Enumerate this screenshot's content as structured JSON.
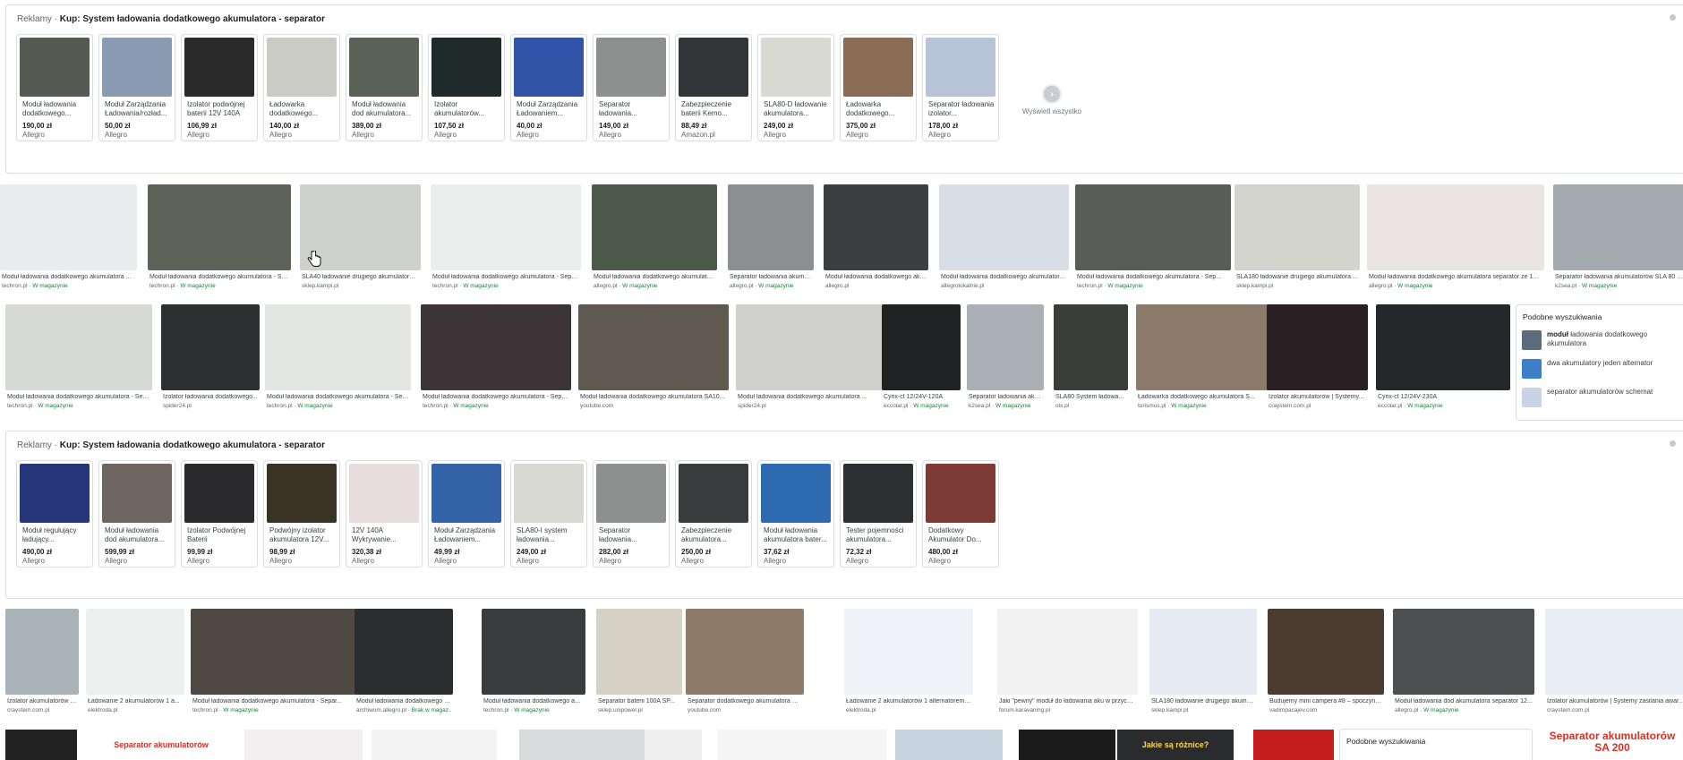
{
  "ads_top": {
    "prefix": "Reklamy · ",
    "title": "Kup: System ładowania dodatkowego akumulatora - separator",
    "cards": [
      {
        "title": "Moduł ładowania dodatkowego...",
        "price": "190,00 zł",
        "store": "Allegro",
        "color": "#555b52"
      },
      {
        "title": "Moduł Zarządzania Ładowania/rozład...",
        "price": "50,00 zł",
        "store": "Allegro",
        "color": "#8a9bb3"
      },
      {
        "title": "Izolator podwójnej baterii 12V 140A",
        "price": "106,99 zł",
        "store": "Allegro",
        "color": "#2a2a2a"
      },
      {
        "title": "Ładowarka dodatkowego...",
        "price": "140,00 zł",
        "store": "Allegro",
        "color": "#c9cbc4"
      },
      {
        "title": "Moduł ładowania dod akumulatora...",
        "price": "389,00 zł",
        "store": "Allegro",
        "color": "#5a6156"
      },
      {
        "title": "Izolator akumulatorów...",
        "price": "107,50 zł",
        "store": "Allegro",
        "color": "#1f2b2a"
      },
      {
        "title": "Moduł Zarządzania Ładowaniem...",
        "price": "40,00 zł",
        "store": "Allegro",
        "color": "#2f54a8"
      },
      {
        "title": "Separator ładowania...",
        "price": "149,00 zł",
        "store": "Allegro",
        "color": "#8e9090"
      },
      {
        "title": "Zabezpieczenie baterii Kemo...",
        "price": "88,49 zł",
        "store": "Amazon.pl",
        "color": "#333638"
      },
      {
        "title": "SLA80-D ładowanie akumulatora...",
        "price": "249,00 zł",
        "store": "Allegro",
        "color": "#d8d9d2"
      },
      {
        "title": "Ładowarka dodatkowego...",
        "price": "375,00 zł",
        "store": "Allegro",
        "color": "#8b6d55"
      },
      {
        "title": "Separator ładowania izolator...",
        "price": "178,00 zł",
        "store": "Allegro",
        "color": "#b7c3d6"
      }
    ],
    "show_all": "Wyświetl wszystko"
  },
  "row1": [
    {
      "cap": "Moduł ładowania dodatkowego akumulatora ...",
      "src": "techron.pl",
      "stock": " · W magazynie",
      "color": "#e9ecef"
    },
    {
      "cap": "Moduł ładowania dodatkowego akumulatora - Se...",
      "src": "techron.pl",
      "stock": " · W magazynie",
      "color": "#5d6359"
    },
    {
      "cap": "SLA40 ładowanie drugiego akumulatora ...",
      "src": "sklep.kampi.pl",
      "stock": "",
      "color": "#cfd1cc"
    },
    {
      "cap": "Moduł ładowania dodatkowego akumulatora - Separ...",
      "src": "techron.pl",
      "stock": " · W magazynie",
      "color": "#eceeee"
    },
    {
      "cap": "Moduł ładowania dodatkowego akumulatora ...",
      "src": "allegro.pl",
      "stock": " · W magazynie",
      "color": "#4c5a4a"
    },
    {
      "cap": "Separator ładowania akumul...",
      "src": "allegro.pl",
      "stock": " · W magazynie",
      "color": "#8c8f91"
    },
    {
      "cap": "Moduł ładowania dodatkowego aku...",
      "src": "allegro.pl",
      "stock": "",
      "color": "#3c3f42"
    },
    {
      "cap": "Moduł ładowania dodatkowego akumulator...",
      "src": "allegrolokalnie.pl",
      "stock": "",
      "color": "#d9dde6"
    },
    {
      "cap": "Moduł ładowania dodatkowego akumulatora - Sep...",
      "src": "techron.pl",
      "stock": " · W magazynie",
      "color": "#5a5c57"
    },
    {
      "cap": "SLA180 ładowanie drugiego akumulatora ...",
      "src": "sklep.kampi.pl",
      "stock": "",
      "color": "#d3d4ce"
    },
    {
      "cap": "Moduł ładowania dodatkowego akumulatora separator ze 190...",
      "src": "allegro.pl",
      "stock": " · W magazynie",
      "color": "#eae4e4"
    },
    {
      "cap": "Separator ładowania akumulatorów SLA 80 D-...",
      "src": "k2sea.pl",
      "stock": " · W magazynie",
      "color": "#a3abb0"
    }
  ],
  "row2": [
    {
      "cap": "Moduł ładowania dodatkowego akumulatora - Sep...",
      "src": "techron.pl",
      "stock": " · W magazynie",
      "color": "#d5d8d3"
    },
    {
      "cap": "Izolator ładowania dodatkowego...",
      "src": "spider24.pl",
      "stock": "",
      "color": "#2d2f31"
    },
    {
      "cap": "Moduł ładowania dodatkowego akumulatora - Sep...",
      "src": "techron.pl",
      "stock": " · W magazynie",
      "color": "#e4e6e3"
    },
    {
      "cap": "Moduł ładowania dodatkowego akumulatora - Separ...",
      "src": "techron.pl",
      "stock": " · W magazynie",
      "color": "#3b3538"
    },
    {
      "cap": "Moduł ładowania dodatkowego akumulatora SA10...",
      "src": "youtube.com",
      "stock": "",
      "color": "#5e5a50"
    },
    {
      "cap": "Moduł ładowania dodatkowego akumulatora ...",
      "src": "spider24.pl",
      "stock": "",
      "color": "#cfd0cc"
    },
    {
      "cap": "Cyrix-ct 12/24V-120A",
      "src": "eccolar.pl",
      "stock": " · W magazynie",
      "color": "#1f2123"
    },
    {
      "cap": "Separator ładowania aku...",
      "src": "k2sea.pl",
      "stock": " · W magazynie",
      "color": "#a9b1b6"
    },
    {
      "cap": "SLA80 System ładowa...",
      "src": "olx.pl",
      "stock": "",
      "color": "#3b3d38"
    },
    {
      "cap": "Ładowarka dodatkowego akumulatora S...",
      "src": "turismus.pl",
      "stock": " · W magazynie",
      "color": "#8c7b6a"
    },
    {
      "cap": "Izolator akumulatorów | Systemy...",
      "src": "craystem.com.pl",
      "stock": "",
      "color": "#2a2124"
    },
    {
      "cap": "Cyrix-ct 12/24V-230A",
      "src": "eccolar.pl",
      "stock": " · W magazynie",
      "color": "#25282b"
    }
  ],
  "related_top": {
    "title": "Podobne wyszukiwania",
    "items": [
      {
        "bold": "moduł",
        "rest": " ładowania dodatkowego akumulatora",
        "color": "#5b6c7a"
      },
      {
        "bold": "",
        "rest": "dwa akumulatory jeden alternator",
        "color": "#3d7ec8"
      },
      {
        "bold": "",
        "rest": "separator akumulatorów schemat",
        "color": "#c9d3e6"
      }
    ]
  },
  "ads_bottom": {
    "prefix": "Reklamy · ",
    "title": "Kup: System ładowania dodatkowego akumulatora - separator",
    "cards": [
      {
        "title": "Moduł regulujący ładujący...",
        "price": "490,00 zł",
        "store": "Allegro",
        "color": "#24357a"
      },
      {
        "title": "Moduł ładowania dod akumulatora...",
        "price": "599,99 zł",
        "store": "Allegro",
        "color": "#6d6660"
      },
      {
        "title": "Izolator Podwójnej Baterii",
        "price": "99,99 zł",
        "store": "Allegro",
        "color": "#2a2a2c"
      },
      {
        "title": "Podwójny izolator akumulatora 12V...",
        "price": "98,99 zł",
        "store": "Allegro",
        "color": "#3a3324"
      },
      {
        "title": "12V 140A Wykrywanie...",
        "price": "320,38 zł",
        "store": "Allegro",
        "color": "#e8dcdc"
      },
      {
        "title": "Moduł Zarządzania Ładowaniem...",
        "price": "49,99 zł",
        "store": "Allegro",
        "color": "#3563a8"
      },
      {
        "title": "SLA80-I system ładowania...",
        "price": "249,00 zł",
        "store": "Allegro",
        "color": "#d8d9d2"
      },
      {
        "title": "Separator ładowania...",
        "price": "282,00 zł",
        "store": "Allegro",
        "color": "#8e9090"
      },
      {
        "title": "Zabezpieczenie akumulatora...",
        "price": "250,00 zł",
        "store": "Allegro",
        "color": "#3a3b3d"
      },
      {
        "title": "Moduł ładowania akumulatora bater...",
        "price": "37,62 zł",
        "store": "Allegro",
        "color": "#2e6ab0"
      },
      {
        "title": "Tester pojemności akumulatora...",
        "price": "72,32 zł",
        "store": "Allegro",
        "color": "#2d2f33"
      },
      {
        "title": "Dodatkowy Akumulator Do...",
        "price": "480,00 zł",
        "store": "Allegro",
        "color": "#7e3a34"
      }
    ]
  },
  "row3": [
    {
      "cap": "Izolator akumulatorów |...",
      "src": "craystem.com.pl",
      "stock": "",
      "color": "#a9b2b7"
    },
    {
      "cap": "Ładowanie 2 akumulatorów 1 a...",
      "src": "elektroda.pl",
      "stock": "",
      "color": "#eef0f0"
    },
    {
      "cap": "Moduł ładowania dodatkowego akumulatora - Separ...",
      "src": "techron.pl",
      "stock": " · W magazynie",
      "color": "#4f4a44"
    },
    {
      "cap": "Moduł ładowania dodatkowego a...",
      "src": "archiwum.allegro.pl",
      "stock": " · Brak w magaz...",
      "color": "#2c2d2f"
    },
    {
      "cap": "Moduł ładowania dodatkowego akumulatora...",
      "src": "techron.pl",
      "stock": " · W magazynie",
      "color": "#3a3b3c"
    },
    {
      "cap": "Separator baterii 100A SP...",
      "src": "sklep.unipower.pl",
      "stock": "",
      "color": "#d6d2c6"
    },
    {
      "cap": "Separator dodatkowego akumulatora SA-40 prezen...",
      "src": "youtube.com",
      "stock": "",
      "color": "#8e7b6a"
    },
    {
      "cap": "Ładowanie 2 akumulatorów 1 alternatorem - ...",
      "src": "elektroda.pl",
      "stock": "",
      "color": "#eef1f5"
    },
    {
      "cap": "Jaki \"pewny\" moduł do ładowania aku w przyczepie p...",
      "src": "forum.karavaning.pl",
      "stock": "",
      "color": "#f2f2f2"
    },
    {
      "cap": "SLA180 ładowanie drugiego akumul...",
      "src": "sklep.kampi.pl",
      "stock": "",
      "color": "#e6ebf3"
    },
    {
      "cap": "Budujemy mini campera #8 – spoczynk...",
      "src": "vadimpacajev.com",
      "stock": "",
      "color": "#4c3b2f"
    },
    {
      "cap": "Moduł ładowania dod akumulatora separator 12...",
      "src": "allegro.pl",
      "stock": " · W magazynie",
      "color": "#4d4f50"
    },
    {
      "cap": "Izolator akumulatorów | Systemy zasilania awaryj...",
      "src": "craystem.com.pl",
      "stock": "",
      "color": "#e9edf5"
    }
  ],
  "row4": [
    {
      "color": "#222"
    },
    {
      "color": "#fff",
      "text": "Separator akumulatorów"
    },
    {
      "color": "#f3eef0"
    },
    {
      "color": "#f4f4f4"
    },
    {
      "color": "#d9dbdc"
    },
    {
      "color": "#eeeeee"
    },
    {
      "color": "#f5f5f5"
    },
    {
      "color": "#c8d4df"
    },
    {
      "color": "#1b1b1b"
    },
    {
      "color": "#2a2b2d",
      "text": "Jakie są różnice?"
    },
    {
      "color": "#c51d1d"
    }
  ],
  "related_bottom": {
    "title": "Podobne wyszukiwania"
  },
  "corner_ad": {
    "line1": "Separator akumulatorów",
    "line2": "SA 200"
  }
}
